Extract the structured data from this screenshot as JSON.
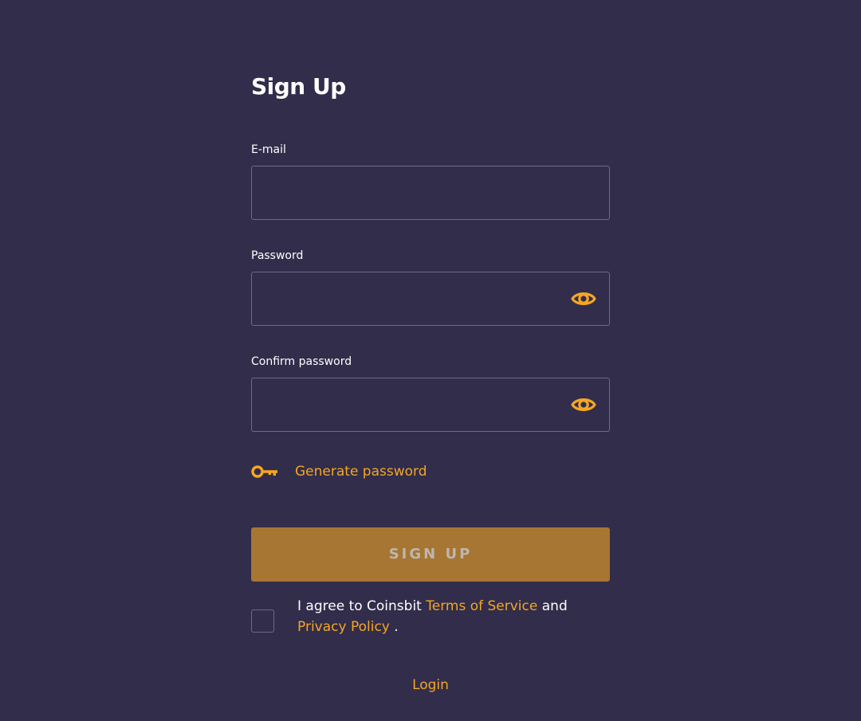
{
  "page": {
    "title": "Sign Up"
  },
  "fields": {
    "email": {
      "label": "E-mail",
      "value": "",
      "placeholder": ""
    },
    "password": {
      "label": "Password",
      "value": "",
      "placeholder": ""
    },
    "confirm_password": {
      "label": "Confirm password",
      "value": "",
      "placeholder": ""
    }
  },
  "generate_password": {
    "label": "Generate password",
    "icon": "key-icon"
  },
  "icons": {
    "show_password": "eye-icon",
    "generate": "key-icon"
  },
  "submit": {
    "label": "SIGN UP"
  },
  "agreement": {
    "checked": false,
    "prefix": "I agree to Coinsbit",
    "terms_link": "Terms of Service",
    "conjunction": "and",
    "privacy_link": "Privacy Policy",
    "suffix": "."
  },
  "footer": {
    "login_link": "Login"
  },
  "colors": {
    "background": "#312d4b",
    "accent": "#f5a623",
    "button": "#a67632",
    "border": "#6f6b85"
  }
}
